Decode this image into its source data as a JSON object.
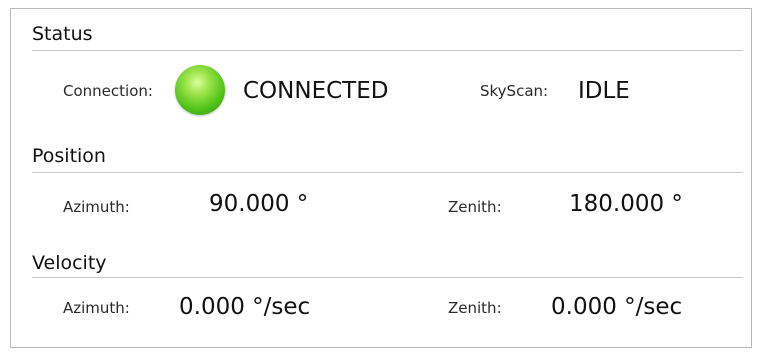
{
  "status": {
    "title": "Status",
    "connection_label": "Connection:",
    "connection_value": "CONNECTED",
    "connection_indicator_color": "#52c41a",
    "skyscan_label": "SkyScan:",
    "skyscan_value": "IDLE"
  },
  "position": {
    "title": "Position",
    "azimuth_label": "Azimuth:",
    "azimuth_value": "90.000 °",
    "zenith_label": "Zenith:",
    "zenith_value": "180.000 °"
  },
  "velocity": {
    "title": "Velocity",
    "azimuth_label": "Azimuth:",
    "azimuth_value": "0.000 °/sec",
    "zenith_label": "Zenith:",
    "zenith_value": "0.000 °/sec"
  }
}
